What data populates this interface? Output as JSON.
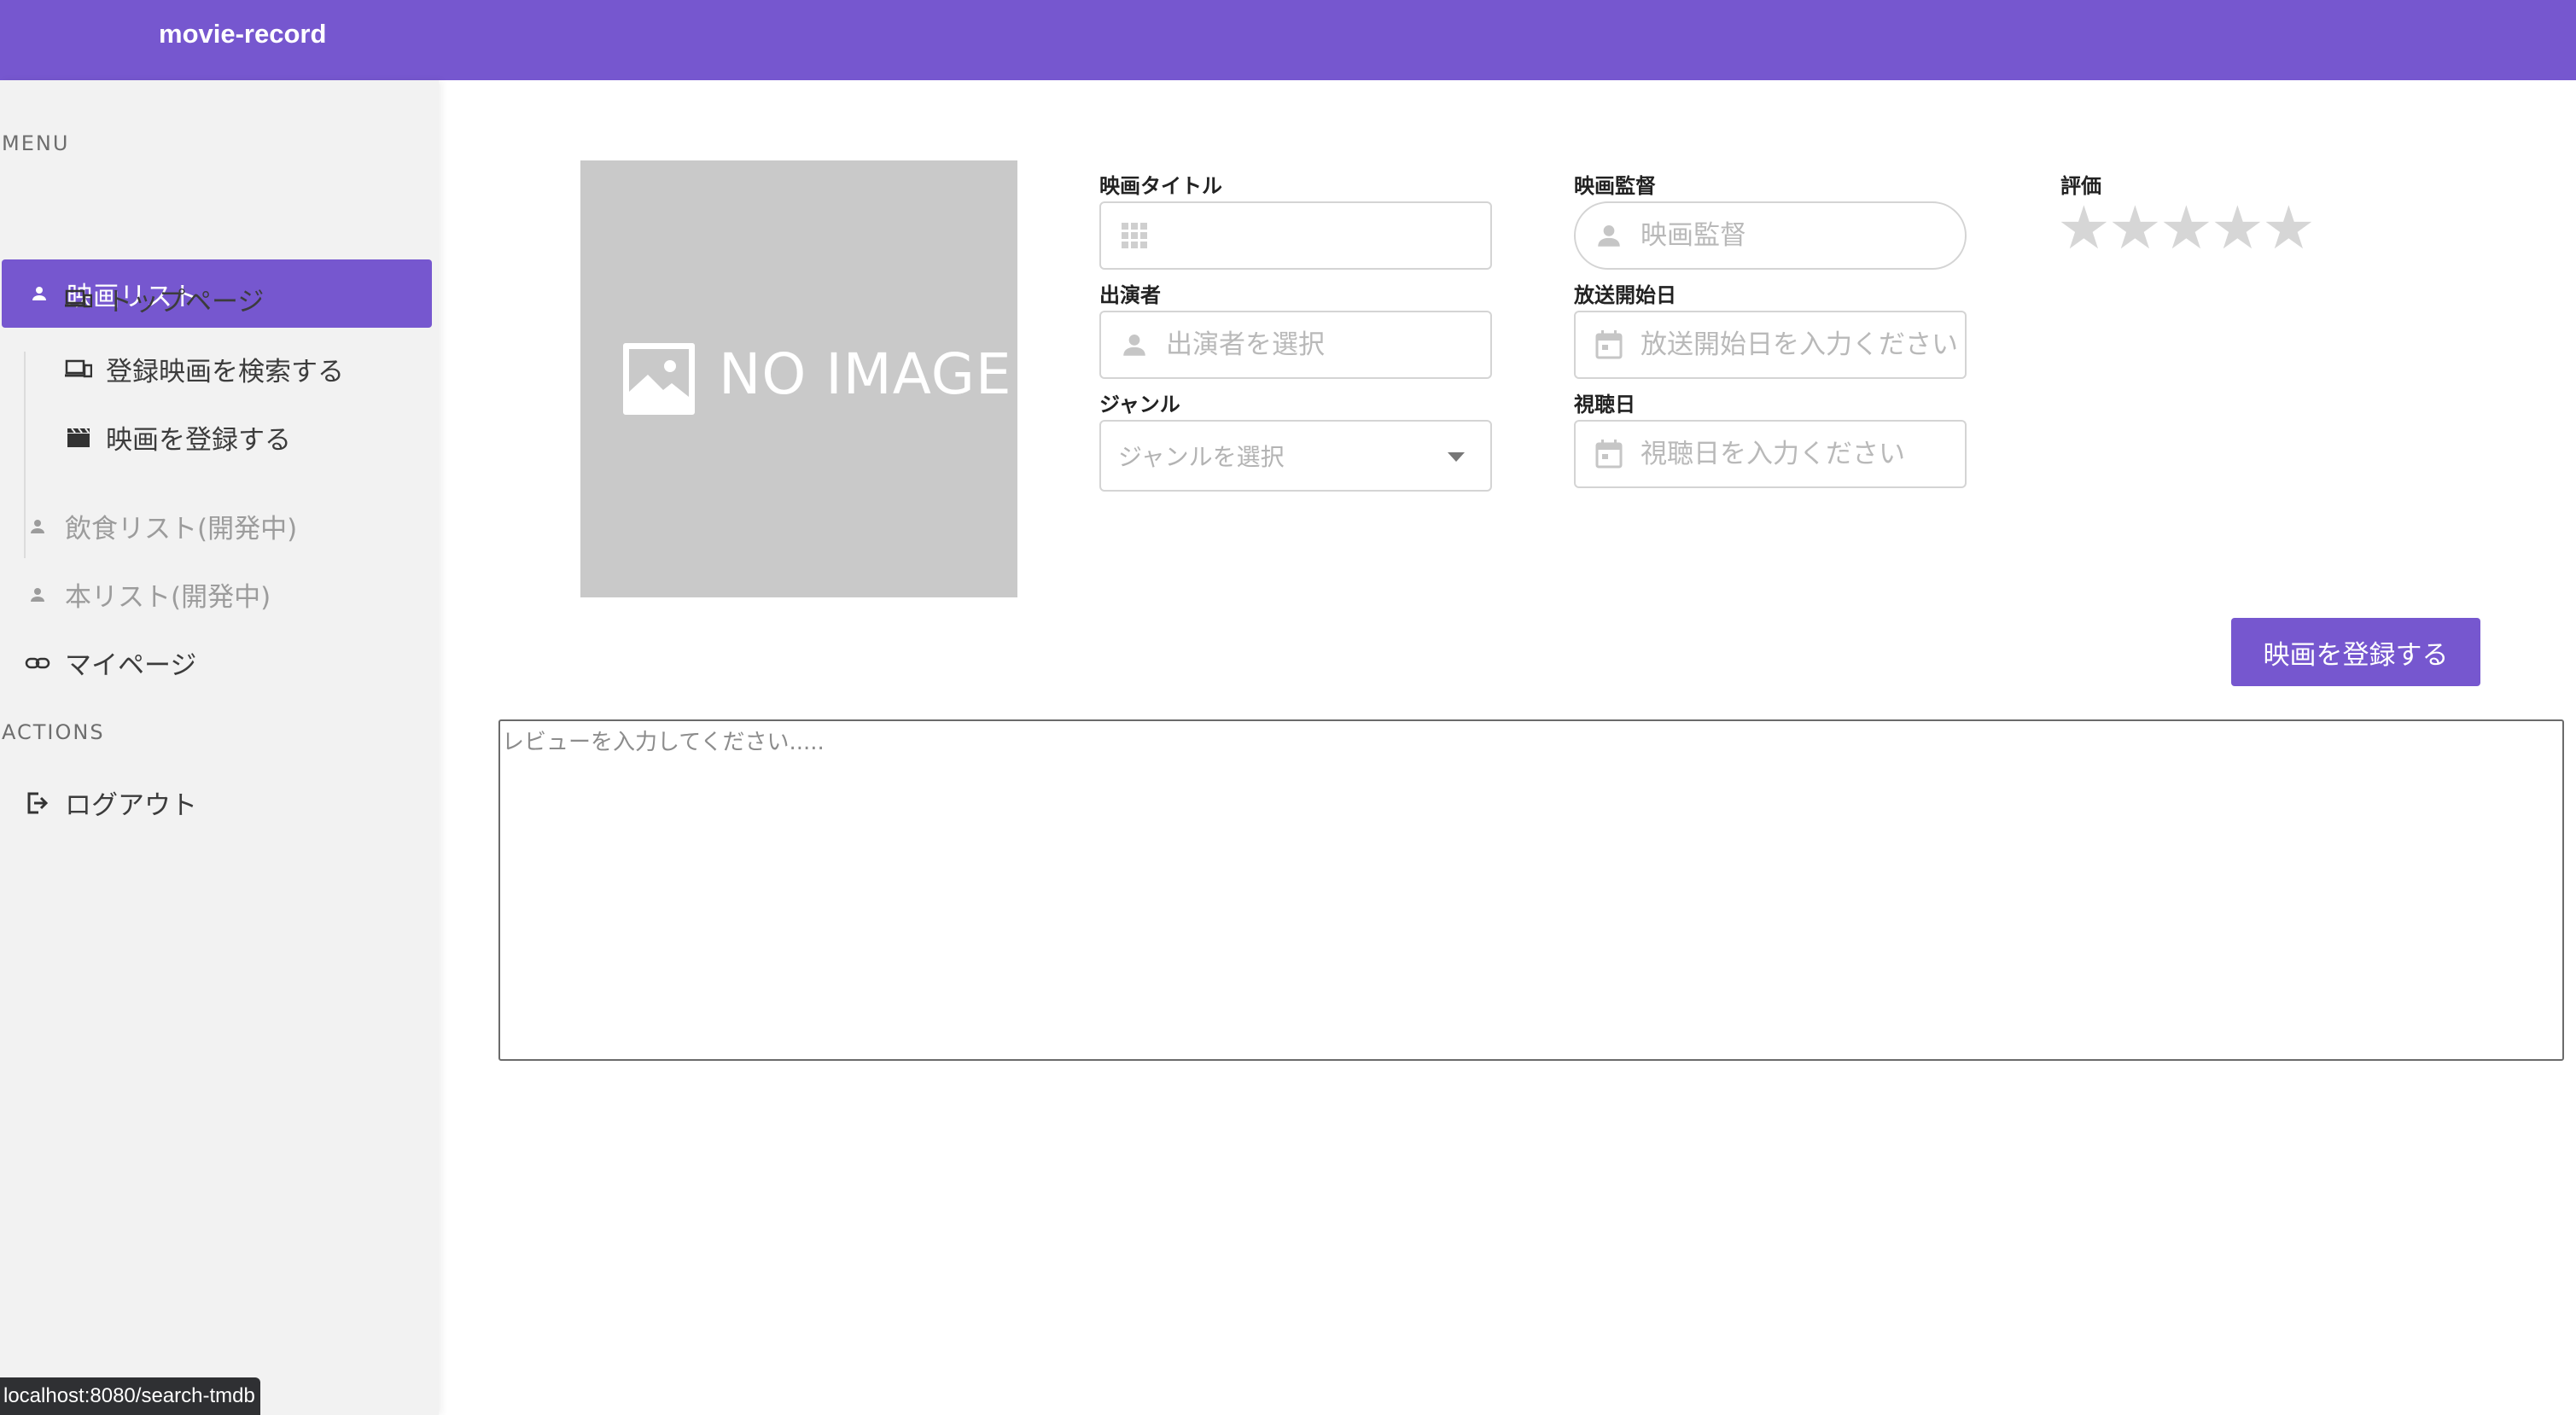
{
  "app": {
    "title": "movie-record"
  },
  "sidebar": {
    "menu_label": "MENU",
    "active_item": {
      "label": "映画リスト",
      "icon": "person-icon"
    },
    "sub_items": [
      {
        "label": "トップページ",
        "icon": "devices-icon"
      },
      {
        "label": "登録映画を検索する",
        "icon": "devices-icon"
      },
      {
        "label": "映画を登録する",
        "icon": "movie-clapper-icon"
      }
    ],
    "items": [
      {
        "label": "飲食リスト(開発中)",
        "icon": "person-icon"
      },
      {
        "label": "本リスト(開発中)",
        "icon": "person-icon"
      },
      {
        "label": "マイページ",
        "icon": "link-icon"
      }
    ],
    "actions_label": "ACTIONS",
    "logout": {
      "label": "ログアウト",
      "icon": "logout-icon"
    }
  },
  "poster": {
    "text": "NO IMAGE"
  },
  "form": {
    "title": {
      "label": "映画タイトル",
      "value": "",
      "placeholder": ""
    },
    "director": {
      "label": "映画監督",
      "placeholder": "映画監督"
    },
    "rating": {
      "label": "評価",
      "value": 0,
      "max": 5
    },
    "cast": {
      "label": "出演者",
      "placeholder": "出演者を選択"
    },
    "release_date": {
      "label": "放送開始日",
      "placeholder": "放送開始日を入力ください"
    },
    "genre": {
      "label": "ジャンル",
      "placeholder": "ジャンルを選択"
    },
    "watch_date": {
      "label": "視聴日",
      "placeholder": "視聴日を入力ください"
    },
    "submit_label": "映画を登録する",
    "review_placeholder": "レビューを入力してください....."
  },
  "status_url": "localhost:8080/search-tmdb",
  "colors": {
    "accent": "#7657cf",
    "sidebar_bg": "#f2f2f2"
  }
}
